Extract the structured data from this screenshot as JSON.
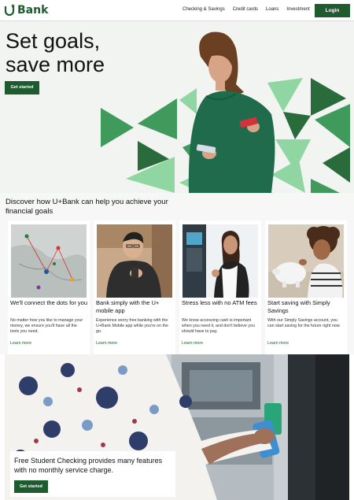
{
  "nav": {
    "brand": "Bank",
    "links": [
      "Checking & Savings",
      "Credit cards",
      "Loans",
      "Investment"
    ],
    "login_label": "Login"
  },
  "hero": {
    "title": "Set goals, save more",
    "cta_label": "Get started"
  },
  "discover": {
    "title": "Discover how U+Bank can help you achieve your financial goals"
  },
  "cards": [
    {
      "title": "We'll connect the dots for you",
      "desc": "No matter how you like to manage your money, we ensure you'll have all the tools you need.",
      "link": "Learn more"
    },
    {
      "title": "Bank simply with the U+ mobile app",
      "desc": "Experience worry free banking with the U+Bank Mobile app while you're on the go.",
      "link": "Learn more"
    },
    {
      "title": "Stress less with no ATM fees",
      "desc": "We know accessing cash is important when you need it, and don't believe you should have to pay.",
      "link": "Learn more"
    },
    {
      "title": "Start saving with Simply Savings",
      "desc": "With our Simply Savings account, you can start saving for the future right now.",
      "link": "Learn more"
    }
  ],
  "promo": {
    "text": "Free Student Checking provides many features with no monthly service charge.",
    "cta_label": "Get started"
  },
  "colors": {
    "brand_green": "#1e5b2e",
    "light_green": "#8fd6a2",
    "mid_green": "#3f9a5c"
  }
}
